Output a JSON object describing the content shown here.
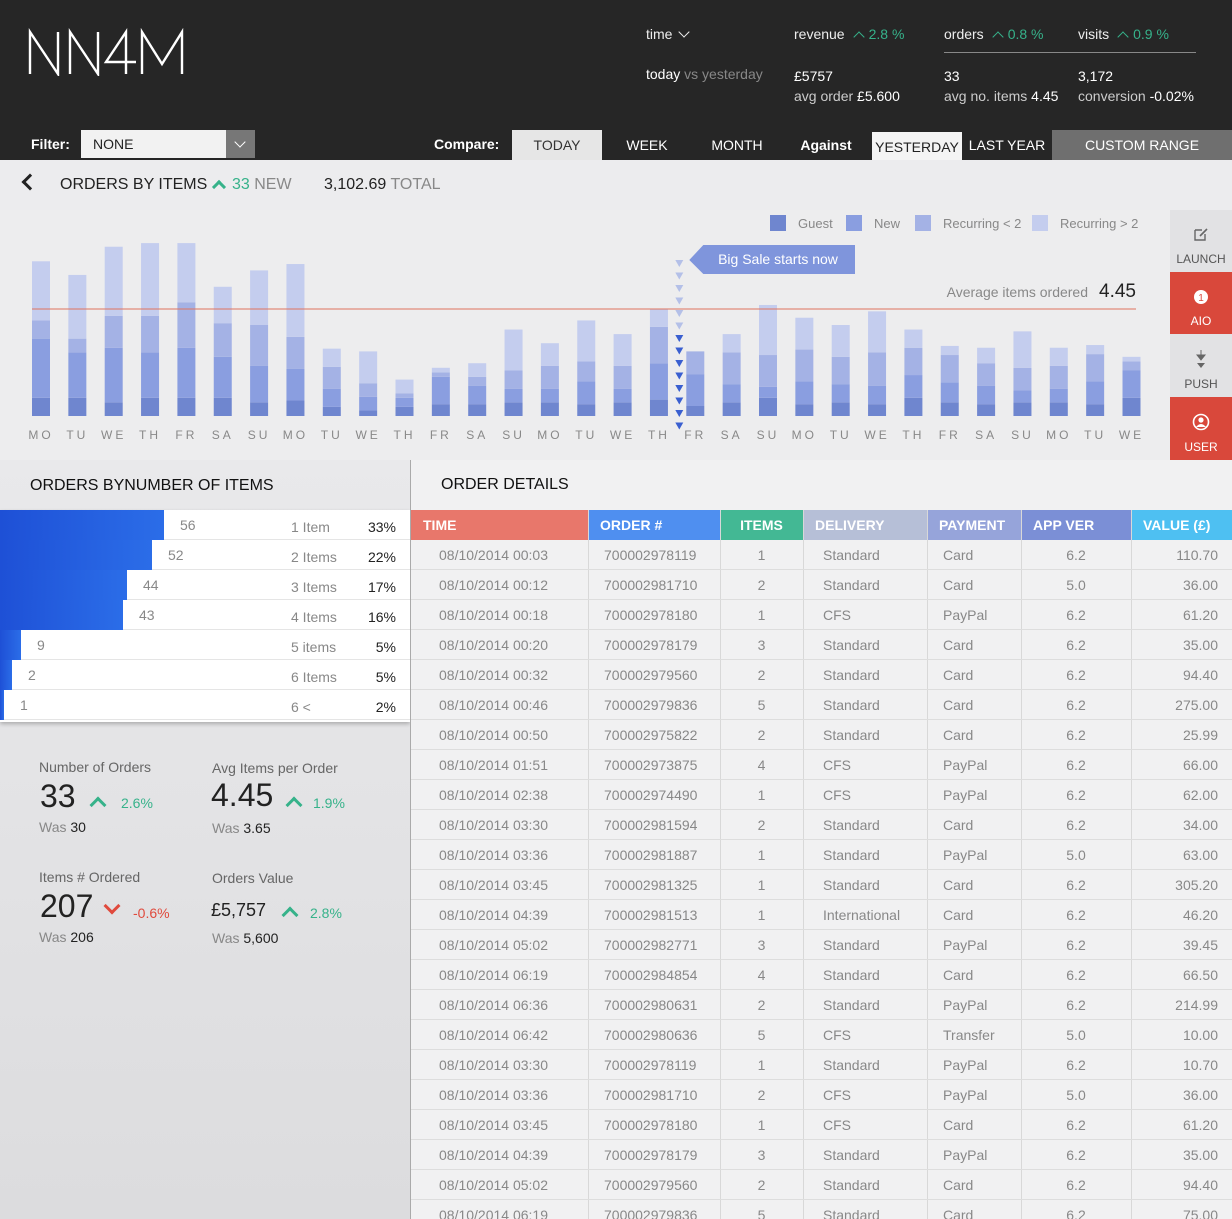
{
  "header": {
    "logo_text": "NN4M",
    "time_label": "time",
    "today_label": "today",
    "vs_label": "vs yesterday",
    "revenue": {
      "label": "revenue",
      "change": "2.8 %",
      "value": "£5757",
      "sub_label": "avg order",
      "sub_value": "£5.600"
    },
    "orders": {
      "label": "orders",
      "change": "0.8 %",
      "value": "33",
      "sub_label": "avg no. items",
      "sub_value": "4.45"
    },
    "visits": {
      "label": "visits",
      "change": "0.9 %",
      "value": "3,172",
      "sub_label": "conversion",
      "sub_value": "-0.02%"
    }
  },
  "filterbar": {
    "filter_label": "Filter:",
    "filter_value": "NONE",
    "compare_label": "Compare:",
    "compare_options": [
      "TODAY",
      "WEEK",
      "MONTH"
    ],
    "against_label": "Against",
    "against_options": [
      "YESTERDAY",
      "LAST YEAR",
      "CUSTOM RANGE"
    ]
  },
  "section": {
    "title": "ORDERS BY ITEMS",
    "new_count": "33",
    "new_label": "NEW",
    "total_value": "3,102.69",
    "total_label": "TOTAL"
  },
  "chart_data": {
    "type": "bar",
    "stacked": true,
    "categories": [
      "MO",
      "TU",
      "WE",
      "TH",
      "FR",
      "SA",
      "SU",
      "MO",
      "TU",
      "WE",
      "TH",
      "FR",
      "SA",
      "SU",
      "MO",
      "TU",
      "WE",
      "TH",
      "FR",
      "SA",
      "SU",
      "MO",
      "TU",
      "WE",
      "TH",
      "FR",
      "SA",
      "SU",
      "MO",
      "TU",
      "WE"
    ],
    "series": [
      {
        "name": "Guest",
        "color": "#6f86cf",
        "values": [
          20,
          20,
          15,
          20,
          20,
          20,
          15,
          17,
          10,
          6,
          10,
          13,
          13,
          15,
          15,
          13,
          15,
          18,
          11,
          15,
          20,
          13,
          15,
          13,
          20,
          15,
          13,
          15,
          15,
          13,
          20
        ]
      },
      {
        "name": "New",
        "color": "#8a9ee0",
        "values": [
          65,
          50,
          60,
          50,
          55,
          45,
          40,
          35,
          20,
          15,
          10,
          30,
          20,
          15,
          15,
          25,
          15,
          40,
          35,
          20,
          12,
          25,
          20,
          20,
          25,
          22,
          20,
          13,
          15,
          25,
          30
        ]
      },
      {
        "name": "Recurring < 2",
        "color": "#a4b2e5",
        "values": [
          20,
          15,
          35,
          40,
          50,
          37,
          45,
          35,
          24,
          15,
          5,
          5,
          10,
          20,
          25,
          22,
          25,
          40,
          25,
          35,
          35,
          35,
          30,
          37,
          30,
          30,
          25,
          25,
          25,
          30,
          10
        ]
      },
      {
        "name": "Recurring > 2",
        "color": "#c4cdee",
        "values": [
          65,
          70,
          76,
          80,
          65,
          40,
          60,
          80,
          20,
          35,
          15,
          5,
          15,
          45,
          25,
          45,
          35,
          20,
          0,
          20,
          55,
          35,
          35,
          45,
          20,
          10,
          17,
          40,
          20,
          10,
          5
        ]
      }
    ],
    "average_label": "Average items ordered",
    "average_value": "4.45",
    "annotation": "Big Sale starts now",
    "annotation_index": 18,
    "legend_position": "top-right"
  },
  "side_buttons": [
    {
      "label": "LAUNCH",
      "icon": "edit-icon"
    },
    {
      "label": "AIO",
      "icon": "aio-icon"
    },
    {
      "label": "PUSH",
      "icon": "push-icon"
    },
    {
      "label": "USER",
      "icon": "user-icon"
    }
  ],
  "distribution": {
    "title": "ORDERS BYNUMBER OF ITEMS",
    "rows": [
      {
        "count": "56",
        "label": "1 Item",
        "pct": "33%",
        "share": 0.4
      },
      {
        "count": "52",
        "label": "2 Items",
        "pct": "22%",
        "share": 0.37
      },
      {
        "count": "44",
        "label": "3 Items",
        "pct": "17%",
        "share": 0.31
      },
      {
        "count": "43",
        "label": "4 Items",
        "pct": "16%",
        "share": 0.3
      },
      {
        "count": "9",
        "label": "5 items",
        "pct": "5%",
        "share": 0.05
      },
      {
        "count": "2",
        "label": "6 Items",
        "pct": "5%",
        "share": 0.03
      },
      {
        "count": "1",
        "label": "6 <",
        "pct": "2%",
        "share": 0.01
      }
    ]
  },
  "stats": {
    "orders": {
      "label": "Number of Orders",
      "value": "33",
      "change": "2.6%",
      "was_label": "Was",
      "was": "30"
    },
    "avg_items": {
      "label": "Avg Items per Order",
      "value": "4.45",
      "change": "1.9%",
      "was_label": "Was",
      "was": "3.65"
    },
    "items_ordered": {
      "label": "Items # Ordered",
      "value": "207",
      "change": "-0.6%",
      "was_label": "Was",
      "was": "206"
    },
    "orders_value": {
      "label": "Orders Value",
      "value": "£5,757",
      "change": "2.8%",
      "was_label": "Was",
      "was": "5,600"
    }
  },
  "order_details": {
    "title": "ORDER DETAILS",
    "columns": [
      {
        "label": "TIME",
        "color": "#e8776b"
      },
      {
        "label": "ORDER #",
        "color": "#4f8ff0"
      },
      {
        "label": "ITEMS",
        "color": "#43b894"
      },
      {
        "label": "DELIVERY",
        "color": "#b6bfd7"
      },
      {
        "label": "PAYMENT",
        "color": "#96a4da"
      },
      {
        "label": "APP VER",
        "color": "#7b8fd6"
      },
      {
        "label": "VALUE (£)",
        "color": "#4ec0f2"
      }
    ],
    "rows": [
      [
        "08/10/2014 00:03",
        "700002978119",
        "1",
        "Standard",
        "Card",
        "6.2",
        "110.70"
      ],
      [
        "08/10/2014 00:12",
        "700002981710",
        "2",
        "Standard",
        "Card",
        "5.0",
        "36.00"
      ],
      [
        "08/10/2014 00:18",
        "700002978180",
        "1",
        "CFS",
        "PayPal",
        "6.2",
        "61.20"
      ],
      [
        "08/10/2014 00:20",
        "700002978179",
        "3",
        "Standard",
        "Card",
        "6.2",
        "35.00"
      ],
      [
        "08/10/2014 00:32",
        "700002979560",
        "2",
        "Standard",
        "Card",
        "6.2",
        "94.40"
      ],
      [
        "08/10/2014 00:46",
        "700002979836",
        "5",
        "Standard",
        "Card",
        "6.2",
        "275.00"
      ],
      [
        "08/10/2014 00:50",
        "700002975822",
        "2",
        "Standard",
        "Card",
        "6.2",
        "25.99"
      ],
      [
        "08/10/2014 01:51",
        "700002973875",
        "4",
        "CFS",
        "PayPal",
        "6.2",
        "66.00"
      ],
      [
        "08/10/2014 02:38",
        "700002974490",
        "1",
        "CFS",
        "PayPal",
        "6.2",
        "62.00"
      ],
      [
        "08/10/2014 03:30",
        "700002981594",
        "2",
        "Standard",
        "Card",
        "6.2",
        "34.00"
      ],
      [
        "08/10/2014 03:36",
        "700002981887",
        "1",
        "Standard",
        "PayPal",
        "5.0",
        "63.00"
      ],
      [
        "08/10/2014 03:45",
        "700002981325",
        "1",
        "Standard",
        "Card",
        "6.2",
        "305.20"
      ],
      [
        "08/10/2014 04:39",
        "700002981513",
        "1",
        "International",
        "Card",
        "6.2",
        "46.20"
      ],
      [
        "08/10/2014 05:02",
        "700002982771",
        "3",
        "Standard",
        "PayPal",
        "6.2",
        "39.45"
      ],
      [
        "08/10/2014 06:19",
        "700002984854",
        "4",
        "Standard",
        "Card",
        "6.2",
        "66.50"
      ],
      [
        "08/10/2014 06:36",
        "700002980631",
        "2",
        "Standard",
        "PayPal",
        "6.2",
        "214.99"
      ],
      [
        "08/10/2014 06:42",
        "700002980636",
        "5",
        "CFS",
        "Transfer",
        "5.0",
        "10.00"
      ],
      [
        "08/10/2014 03:30",
        "700002978119",
        "1",
        "Standard",
        "PayPal",
        "6.2",
        "10.70"
      ],
      [
        "08/10/2014 03:36",
        "700002981710",
        "2",
        "CFS",
        "PayPal",
        "5.0",
        "36.00"
      ],
      [
        "08/10/2014 03:45",
        "700002978180",
        "1",
        "CFS",
        "Card",
        "6.2",
        "61.20"
      ],
      [
        "08/10/2014 04:39",
        "700002978179",
        "3",
        "Standard",
        "PayPal",
        "6.2",
        "35.00"
      ],
      [
        "08/10/2014 05:02",
        "700002979560",
        "2",
        "Standard",
        "Card",
        "6.2",
        "94.40"
      ],
      [
        "08/10/2014 06:19",
        "700002979836",
        "5",
        "Standard",
        "Card",
        "6.2",
        "75.00"
      ]
    ]
  }
}
